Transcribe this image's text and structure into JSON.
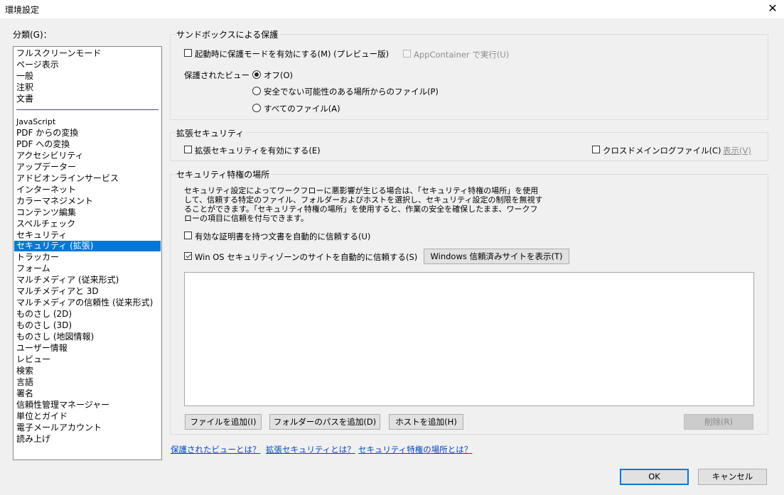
{
  "window": {
    "title": "環境設定",
    "close_glyph": "✕"
  },
  "category": {
    "label": "分類(G)：",
    "items": [
      "フルスクリーンモード",
      "ページ表示",
      "一般",
      "注釈",
      "文書",
      "JavaScript",
      "PDF からの変換",
      "PDF への変換",
      "アクセシビリティ",
      "アップデーター",
      "アドビオンラインサービス",
      "インターネット",
      "カラーマネジメント",
      "コンテンツ編集",
      "スペルチェック",
      "セキュリティ",
      "セキュリティ (拡張)",
      "トラッカー",
      "フォーム",
      "マルチメディア (従来形式)",
      "マルチメディアと 3D",
      "マルチメディアの信頼性 (従来形式)",
      "ものさし (2D)",
      "ものさし (3D)",
      "ものさし (地図情報)",
      "ユーザー情報",
      "レビュー",
      "検索",
      "言語",
      "署名",
      "信頼性管理マネージャー",
      "単位とガイド",
      "電子メールアカウント",
      "読み上げ"
    ],
    "selected": "セキュリティ (拡張)"
  },
  "sandbox": {
    "title": "サンドボックスによる保護",
    "protected_mode": {
      "label": "起動時に保護モードを有効にする(M) (プレビュー版)",
      "checked": false
    },
    "app_container": {
      "label": "AppContainer で実行(U)",
      "checked": false,
      "enabled": false
    },
    "protected_view_label": "保護されたビュー",
    "options": [
      {
        "label": "オフ(O)",
        "selected": true
      },
      {
        "label": "安全でない可能性のある場所からのファイル(P)",
        "selected": false
      },
      {
        "label": "すべてのファイル(A)",
        "selected": false
      }
    ]
  },
  "enhanced": {
    "title": "拡張セキュリティ",
    "enable": {
      "label": "拡張セキュリティを有効にする(E)",
      "checked": false
    },
    "crossdomain": {
      "label": "クロスドメインログファイル(C)",
      "checked": false
    },
    "view_button": "表示(V)"
  },
  "privileged": {
    "title": "セキュリティ特権の場所",
    "description": [
      "セキュリティ設定によってワークフローに悪影響が生じる場合は、「セキュリティ特権の場所」を使用",
      "して、信頼する特定のファイル、フォルダーおよびホストを選択し、セキュリティ設定の制限を無視す",
      "ることができます。「セキュリティ特権の場所」を使用すると、作業の安全を確保したまま、ワークフ",
      "ローの項目に信頼を付与できます。"
    ],
    "trust_certified": {
      "label": "有効な証明書を持つ文書を自動的に信頼する(U)",
      "checked": false
    },
    "trust_winos": {
      "label": "Win OS セキュリティゾーンのサイトを自動的に信頼する(S)",
      "checked": true
    },
    "show_trusted_sites_button": "Windows 信頼済みサイトを表示(T)",
    "add_file_button": "ファイルを追加(I)",
    "add_folder_button": "フォルダーのパスを追加(D)",
    "add_host_button": "ホストを追加(H)",
    "delete_button": "削除(R)"
  },
  "links": [
    "保護されたビューとは？",
    "拡張セキュリティとは？",
    "セキュリティ特権の場所とは？"
  ],
  "footer": {
    "ok": "OK",
    "cancel": "キャンセル"
  }
}
